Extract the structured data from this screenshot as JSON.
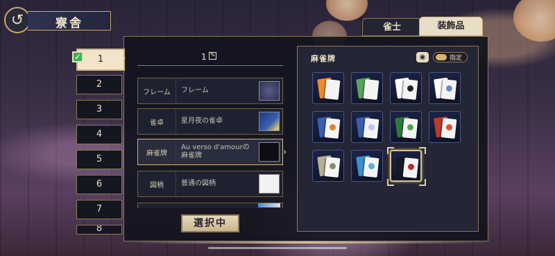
{
  "header": {
    "back_icon": "↺",
    "title": "寮舎"
  },
  "tabs": [
    {
      "label": "雀士",
      "active": false
    },
    {
      "label": "装飾品",
      "active": true
    }
  ],
  "slots": [
    "1",
    "2",
    "3",
    "4",
    "5",
    "6",
    "7",
    "8"
  ],
  "current_set": {
    "name": "1"
  },
  "rows": [
    {
      "label": "フレーム",
      "value": "フレーム"
    },
    {
      "label": "雀卓",
      "value": "星月夜の雀卓"
    },
    {
      "label": "麻雀牌",
      "value": "Au verso d'amourの麻雀牌"
    },
    {
      "label": "図柄",
      "value": "普通の図柄"
    }
  ],
  "select_button": "選択中",
  "panel": {
    "title": "麻雀牌",
    "eye_icon": "◉",
    "toggle_label": "指定"
  },
  "tiles": [
    {
      "back": "#f08a2a",
      "mark": ""
    },
    {
      "back": "#5aa55a",
      "mark": ""
    },
    {
      "back": "#ffffff",
      "mark": "#222222"
    },
    {
      "back": "#ffffff",
      "mark": "#6a8ad0"
    },
    {
      "back": "#3a5fb0",
      "mark": "#e08030"
    },
    {
      "back": "#3a5fb0",
      "mark": "#c0c0ff"
    },
    {
      "back": "#2e7a3a",
      "mark": "#4aaa4a"
    },
    {
      "back": "#c03a2a",
      "mark": "#e05030"
    },
    {
      "back": "#b8b090",
      "mark": "#8a8a6a"
    },
    {
      "back": "#3a90d0",
      "mark": "#5ab0e0"
    },
    {
      "back": "#1a1a22",
      "mark": "#c02a2a",
      "selected": true
    }
  ],
  "colors": {
    "accent": "#c9a86a",
    "selected_bg": "#f1e4c9",
    "check": "#3db350"
  }
}
